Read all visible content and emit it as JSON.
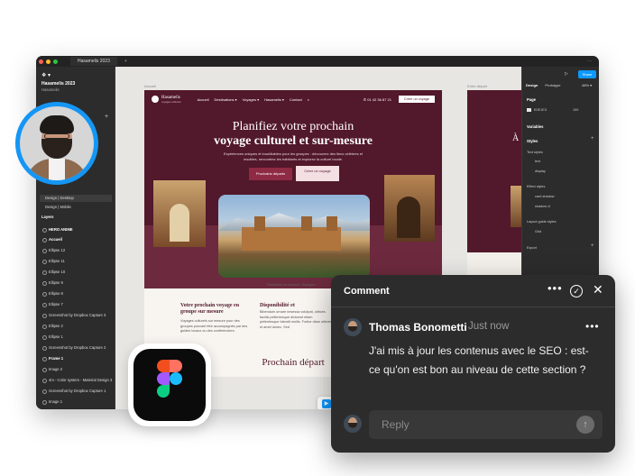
{
  "titlebar": {
    "tab": "Hasamelis 2023",
    "plus": "+",
    "more": "···"
  },
  "left_panel": {
    "logo": "❖ ▾",
    "project": "Hasamelis 2023",
    "project_sub": "Hasamelis",
    "add": "+",
    "pages": [
      "Design | Desktop",
      "Design | Mobile"
    ],
    "layers_title": "Layers",
    "layers": [
      "HERO ANIME",
      "Accueil",
      "Ellipse 12",
      "Ellipse 11",
      "Ellipse 10",
      "Ellipse 9",
      "Ellipse 8",
      "Ellipse 7",
      "Screenshot by Dropbox Capture 3",
      "Ellipse 2",
      "Ellipse 1",
      "Screenshot by Dropbox Capture 2",
      "Frame 1",
      "Image 2",
      "4m - Color system - Material Design 3",
      "Screenshot by Dropbox Capture 1",
      "Image 1"
    ]
  },
  "canvas": {
    "frame_label": "Accueil",
    "frame2_label": "Entre départ",
    "site": {
      "brand": "Hasamelis",
      "brand_sub": "voyages culturels",
      "menu": [
        "Accueil",
        "Destinations ▾",
        "Voyages ▾",
        "Hasamelis ▾",
        "Contact"
      ],
      "search": "⌕",
      "phone": "✆ 01 42 36 87 21",
      "cta": "Créer un voyage",
      "hero_title_line1": "Planifiez votre prochain",
      "hero_title_line2": "voyage culturel et sur-mesure",
      "hero_desc": "Expériences uniques et inoubliables pour les groupes : découvrez des lieux célèbres et insolites, rencontrez les habitants et explorez la culture locale.",
      "btn_primary": "Prochains départs",
      "btn_secondary": "Créer un voyage",
      "photo_caption": "Destination du moment : Espagne ›",
      "sec1_title": "Votre prochain voyage en groupe sur mesure",
      "sec1_desc": "Voyages culturels sur mesure pour des groupes pouvant être accompagnés par des guides locaux ou des conférenciers.",
      "sec2_title": "Disponibilité et",
      "sec2_desc": "Bibendum ornare nesessa volutpat, ultrices facilisi pellentesque dictumst etiam pellentesque blandit mollis. Fortior diam ultrices et amet donec. Sed",
      "section_heading": "Prochain départ"
    },
    "frame2_title": "À la d",
    "toolbar": [
      "▶",
      "#",
      "□",
      "✎",
      "T"
    ]
  },
  "right_panel": {
    "share": "Share",
    "tabs": [
      "Design",
      "Prototype"
    ],
    "zoom": "48% ▾",
    "page_label": "Page",
    "page_color": "E0E1E3",
    "page_opacity": "100",
    "variables": "Variables",
    "styles": "Styles",
    "text_styles": "Text styles",
    "text_items": [
      "text",
      "display"
    ],
    "effect_styles": "Effect styles",
    "effect_items": [
      "card shadow",
      "shadow xl"
    ],
    "layout_guides": "Layout guide styles",
    "layout_items": [
      "Grid"
    ],
    "export": "Export"
  },
  "comment": {
    "title": "Comment",
    "more": "•••",
    "resolve": "✓",
    "close": "✕",
    "author": "Thomas Bonometti",
    "time": "Just now",
    "message": "J'ai mis à jour les contenus avec le SEO : est-ce qu'on est bon au niveau de cette section ?",
    "reply_placeholder": "Reply",
    "send": "↑"
  },
  "colors": {
    "accent": "#0d99ff",
    "brand": "#52182b",
    "figma_red": "#f24e1e",
    "figma_orange": "#ff7262",
    "figma_purple": "#a259ff",
    "figma_blue": "#1abcfe",
    "figma_green": "#0acf83"
  }
}
